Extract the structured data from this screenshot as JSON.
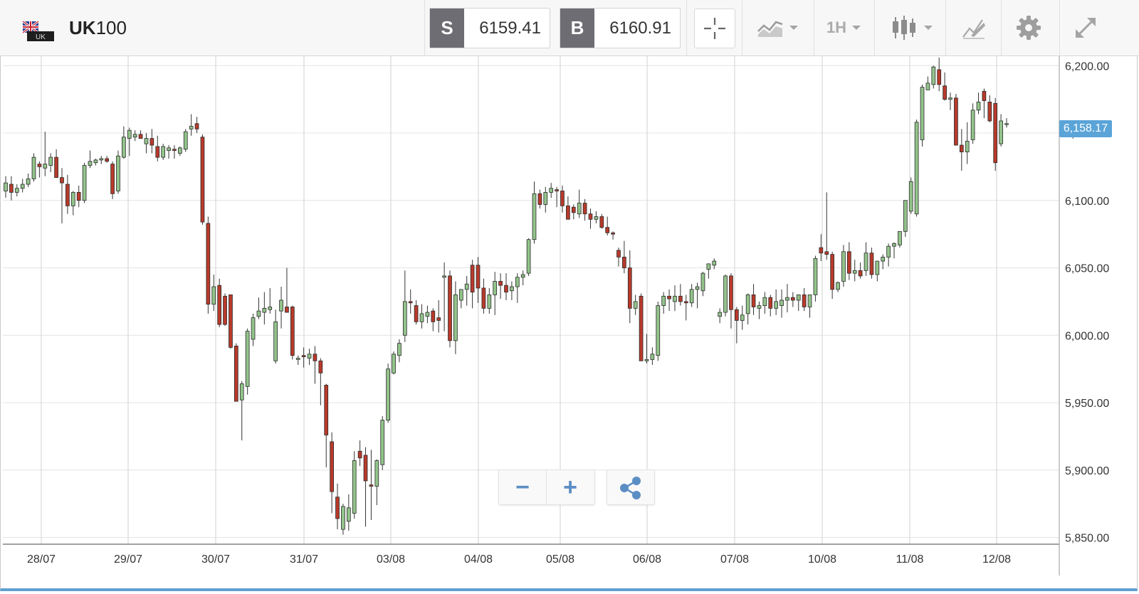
{
  "header": {
    "symbol_prefix": "UK",
    "symbol_suffix": "100",
    "flag_label": "UK",
    "sell": {
      "label": "S",
      "value": "6159.41"
    },
    "buy": {
      "label": "B",
      "value": "6160.91"
    },
    "timeframe": "1H"
  },
  "toolbar_icons": [
    "crosshair-icon",
    "line-chart-icon",
    "candlestick-icon",
    "draw-icon",
    "gear-icon",
    "fullscreen-icon"
  ],
  "zoom_controls": {
    "minus": "−",
    "plus": "+"
  },
  "colors": {
    "bull": "#93c48b",
    "bear": "#b83a2b",
    "wick": "#333333",
    "accent": "#5aa4d8",
    "grid": "#e4e4e4"
  },
  "chart_data": {
    "type": "candlestick",
    "instrument": "UK100",
    "interval": "1H",
    "ylim": [
      5845,
      6207
    ],
    "y_ticks": [
      5850,
      5900,
      5950,
      6000,
      6050,
      6100,
      6150,
      6200
    ],
    "y_tick_labels": [
      "5,850.00",
      "5,900.00",
      "5,950.00",
      "6,000.00",
      "6,050.00",
      "6,100.00",
      "6,150.00",
      "6,200.00"
    ],
    "x_tick_labels": [
      "28/07",
      "29/07",
      "30/07",
      "31/07",
      "03/08",
      "04/08",
      "05/08",
      "06/08",
      "07/08",
      "10/08",
      "11/08",
      "12/08"
    ],
    "last_price": "6,158.17",
    "candles_ohlc": [
      [
        6107,
        6118,
        6102,
        6113
      ],
      [
        6112,
        6118,
        6100,
        6106
      ],
      [
        6106,
        6112,
        6103,
        6109
      ],
      [
        6109,
        6116,
        6106,
        6112
      ],
      [
        6112,
        6120,
        6110,
        6116
      ],
      [
        6116,
        6135,
        6114,
        6132
      ],
      [
        6127,
        6129,
        6117,
        6125
      ],
      [
        6124,
        6151,
        6118,
        6127
      ],
      [
        6126,
        6135,
        6121,
        6132
      ],
      [
        6132,
        6138,
        6126,
        6117
      ],
      [
        6117,
        6124,
        6083,
        6113
      ],
      [
        6112,
        6119,
        6090,
        6096
      ],
      [
        6096,
        6107,
        6089,
        6106
      ],
      [
        6106,
        6111,
        6095,
        6100
      ],
      [
        6100,
        6128,
        6098,
        6126
      ],
      [
        6126,
        6137,
        6124,
        6129
      ],
      [
        6128,
        6131,
        6126,
        6130
      ],
      [
        6130,
        6133,
        6127,
        6131
      ],
      [
        6131,
        6133,
        6128,
        6129
      ],
      [
        6127,
        6129,
        6101,
        6105
      ],
      [
        6107,
        6137,
        6105,
        6133
      ],
      [
        6132,
        6155,
        6131,
        6147
      ],
      [
        6146,
        6154,
        6133,
        6152
      ],
      [
        6147,
        6152,
        6144,
        6149
      ],
      [
        6149,
        6152,
        6146,
        6146
      ],
      [
        6142,
        6150,
        6135,
        6146
      ],
      [
        6146,
        6153,
        6135,
        6141
      ],
      [
        6140,
        6148,
        6129,
        6132
      ],
      [
        6132,
        6142,
        6130,
        6140
      ],
      [
        6137,
        6141,
        6131,
        6139
      ],
      [
        6138,
        6141,
        6131,
        6137
      ],
      [
        6135,
        6140,
        6133,
        6139
      ],
      [
        6138,
        6153,
        6136,
        6151
      ],
      [
        6153,
        6164,
        6148,
        6155
      ],
      [
        6157,
        6162,
        6150,
        6153
      ],
      [
        6147,
        6149,
        6082,
        6084
      ],
      [
        6083,
        6088,
        6016,
        6023
      ],
      [
        6023,
        6045,
        6018,
        6036
      ],
      [
        6037,
        6042,
        6006,
        6008
      ],
      [
        6029,
        6031,
        6007,
        6008
      ],
      [
        6030,
        6030,
        5990,
        5991
      ],
      [
        5992,
        5994,
        5951,
        5951
      ],
      [
        5952,
        5966,
        5922,
        5964
      ],
      [
        5962,
        6005,
        5956,
        6003
      ],
      [
        5997,
        6016,
        5992,
        6013
      ],
      [
        6014,
        6028,
        6012,
        6018
      ],
      [
        6017,
        6032,
        6008,
        6020
      ],
      [
        6019,
        6035,
        6016,
        6021
      ],
      [
        5981,
        6019,
        5979,
        6010
      ],
      [
        6018,
        6036,
        6005,
        6026
      ],
      [
        6021,
        6050,
        6017,
        6017
      ],
      [
        6021,
        6022,
        5982,
        5985
      ],
      [
        5982,
        5985,
        5978,
        5983
      ],
      [
        5985,
        5991,
        5976,
        5984
      ],
      [
        5983,
        5990,
        5978,
        5986
      ],
      [
        5986,
        5992,
        5964,
        5981
      ],
      [
        5981,
        5983,
        5948,
        5972
      ],
      [
        5963,
        5964,
        5902,
        5926
      ],
      [
        5921,
        5928,
        5868,
        5884
      ],
      [
        5880,
        5890,
        5856,
        5864
      ],
      [
        5856,
        5875,
        5852,
        5873
      ],
      [
        5862,
        5882,
        5855,
        5872
      ],
      [
        5868,
        5914,
        5864,
        5907
      ],
      [
        5914,
        5922,
        5903,
        5909
      ],
      [
        5911,
        5917,
        5858,
        5892
      ],
      [
        5889,
        5915,
        5863,
        5888
      ],
      [
        5888,
        5908,
        5874,
        5907
      ],
      [
        5904,
        5940,
        5900,
        5937
      ],
      [
        5937,
        5979,
        5935,
        5975
      ],
      [
        5972,
        5988,
        5971,
        5986
      ],
      [
        5985,
        5997,
        5980,
        5994
      ],
      [
        6000,
        6048,
        5995,
        6025
      ],
      [
        6025,
        6034,
        6016,
        6024
      ],
      [
        6022,
        6026,
        6008,
        6010
      ],
      [
        6010,
        6023,
        6005,
        6016
      ],
      [
        6014,
        6022,
        6009,
        6017
      ],
      [
        6018,
        6020,
        6003,
        6010
      ],
      [
        6013,
        6026,
        6002,
        6011
      ],
      [
        6043,
        6054,
        6003,
        6044
      ],
      [
        6044,
        6048,
        5991,
        5996
      ],
      [
        5996,
        6040,
        5986,
        6030
      ],
      [
        6026,
        6033,
        6020,
        6034
      ],
      [
        6034,
        6044,
        6022,
        6038
      ],
      [
        6052,
        6056,
        6020,
        6032
      ],
      [
        6052,
        6058,
        6024,
        6035
      ],
      [
        6035,
        6042,
        6016,
        6020
      ],
      [
        6020,
        6035,
        6016,
        6030
      ],
      [
        6030,
        6047,
        6015,
        6040
      ],
      [
        6040,
        6046,
        6027,
        6037
      ],
      [
        6037,
        6046,
        6026,
        6032
      ],
      [
        6033,
        6040,
        6026,
        6036
      ],
      [
        6036,
        6046,
        6024,
        6043
      ],
      [
        6043,
        6048,
        6037,
        6045
      ],
      [
        6046,
        6072,
        6044,
        6071
      ],
      [
        6071,
        6114,
        6068,
        6105
      ],
      [
        6105,
        6108,
        6094,
        6097
      ],
      [
        6097,
        6110,
        6091,
        6106
      ],
      [
        6106,
        6113,
        6102,
        6109
      ],
      [
        6108,
        6110,
        6095,
        6107
      ],
      [
        6107,
        6111,
        6091,
        6096
      ],
      [
        6096,
        6103,
        6086,
        6086
      ],
      [
        6095,
        6097,
        6086,
        6091
      ],
      [
        6090,
        6108,
        6087,
        6098
      ],
      [
        6098,
        6101,
        6085,
        6090
      ],
      [
        6090,
        6094,
        6079,
        6086
      ],
      [
        6086,
        6092,
        6083,
        6088
      ],
      [
        6088,
        6090,
        6079,
        6080
      ],
      [
        6080,
        6088,
        6074,
        6076
      ],
      [
        6076,
        6077,
        6071,
        6075
      ],
      [
        6063,
        6065,
        6051,
        6058
      ],
      [
        6058,
        6070,
        6046,
        6050
      ],
      [
        6050,
        6063,
        6009,
        6020
      ],
      [
        6020,
        6030,
        6015,
        6025
      ],
      [
        6029,
        6031,
        5981,
        5981
      ],
      [
        5981,
        6001,
        5979,
        5982
      ],
      [
        5982,
        5991,
        5978,
        5986
      ],
      [
        5985,
        6025,
        5981,
        6022
      ],
      [
        6022,
        6032,
        6016,
        6029
      ],
      [
        6029,
        6034,
        6018,
        6027
      ],
      [
        6025,
        6037,
        6018,
        6029
      ],
      [
        6029,
        6038,
        6022,
        6025
      ],
      [
        6025,
        6030,
        6011,
        6024
      ],
      [
        6024,
        6038,
        6021,
        6034
      ],
      [
        6034,
        6039,
        6020,
        6036
      ],
      [
        6033,
        6047,
        6029,
        6046
      ],
      [
        6049,
        6050,
        6042,
        6053
      ],
      [
        6052,
        6057,
        6049,
        6055
      ],
      [
        6014,
        6020,
        6009,
        6017
      ],
      [
        6017,
        6045,
        6014,
        6044
      ],
      [
        6044,
        6046,
        6005,
        6019
      ],
      [
        6019,
        6021,
        5994,
        6011
      ],
      [
        6011,
        6022,
        6004,
        6015
      ],
      [
        6016,
        6031,
        6008,
        6030
      ],
      [
        6030,
        6038,
        6015,
        6021
      ],
      [
        6020,
        6025,
        6012,
        6022
      ],
      [
        6022,
        6032,
        6016,
        6028
      ],
      [
        6028,
        6030,
        6014,
        6020
      ],
      [
        6020,
        6034,
        6015,
        6025
      ],
      [
        6022,
        6034,
        6013,
        6026
      ],
      [
        6026,
        6038,
        6017,
        6028
      ],
      [
        6028,
        6032,
        6021,
        6026
      ],
      [
        6026,
        6030,
        6018,
        6030
      ],
      [
        6030,
        6035,
        6018,
        6021
      ],
      [
        6021,
        6029,
        6013,
        6030
      ],
      [
        6030,
        6059,
        6025,
        6057
      ],
      [
        6065,
        6075,
        6055,
        6061
      ],
      [
        6062,
        6106,
        6056,
        6060
      ],
      [
        6060,
        6062,
        6027,
        6034
      ],
      [
        6034,
        6040,
        6032,
        6039
      ],
      [
        6040,
        6067,
        6036,
        6062
      ],
      [
        6062,
        6069,
        6041,
        6046
      ],
      [
        6046,
        6056,
        6040,
        6048
      ],
      [
        6048,
        6054,
        6042,
        6044
      ],
      [
        6048,
        6069,
        6044,
        6061
      ],
      [
        6061,
        6065,
        6042,
        6045
      ],
      [
        6045,
        6052,
        6040,
        6055
      ],
      [
        6055,
        6060,
        6049,
        6058
      ],
      [
        6058,
        6068,
        6051,
        6066
      ],
      [
        6066,
        6069,
        6057,
        6068
      ],
      [
        6067,
        6074,
        6065,
        6077
      ],
      [
        6077,
        6097,
        6073,
        6100
      ],
      [
        6092,
        6117,
        6090,
        6114
      ],
      [
        6090,
        6160,
        6088,
        6158
      ],
      [
        6145,
        6186,
        6140,
        6184
      ],
      [
        6182,
        6192,
        6182,
        6187
      ],
      [
        6186,
        6200,
        6183,
        6199
      ],
      [
        6197,
        6206,
        6181,
        6186
      ],
      [
        6185,
        6195,
        6174,
        6175
      ],
      [
        6175,
        6180,
        6167,
        6176
      ],
      [
        6176,
        6179,
        6145,
        6141
      ],
      [
        6141,
        6153,
        6122,
        6136
      ],
      [
        6136,
        6158,
        6127,
        6144
      ],
      [
        6145,
        6172,
        6142,
        6167
      ],
      [
        6167,
        6180,
        6164,
        6173
      ],
      [
        6181,
        6183,
        6161,
        6174
      ],
      [
        6173,
        6178,
        6158,
        6159
      ],
      [
        6172,
        6176,
        6122,
        6128
      ],
      [
        6142,
        6164,
        6140,
        6159
      ],
      [
        6157,
        6161,
        6154,
        6157
      ]
    ]
  }
}
